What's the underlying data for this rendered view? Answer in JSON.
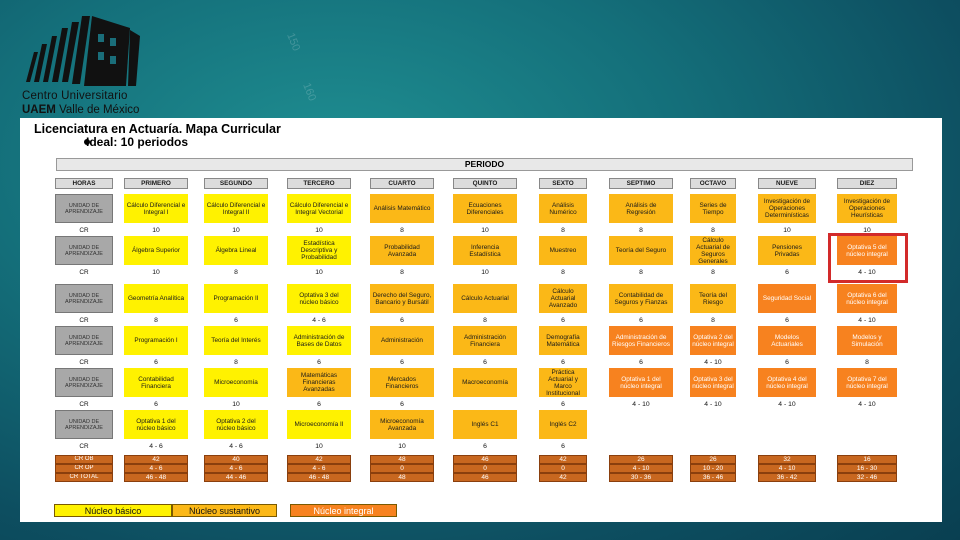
{
  "logo": {
    "line1": "Centro Universitario",
    "line2_bold": "UAEM",
    "line2_rest": " Valle de México"
  },
  "deco": [
    "150",
    "160"
  ],
  "doc": {
    "title": "Licenciatura en Actuaría. Mapa Curricular",
    "subtitle": "Ideal: 10 periodos",
    "periodo": "PERIODO"
  },
  "columns": [
    "HORAS",
    "PRIMERO",
    "SEGUNDO",
    "TERCERO",
    "CUARTO",
    "QUINTO",
    "SEXTO",
    "SEPTIMO",
    "OCTAVO",
    "NUEVE",
    "DIEZ"
  ],
  "row_label": "UNIDAD DE APRENDIZAJE",
  "cr_label": "CR",
  "rows": [
    {
      "cells": [
        {
          "t": "Cálculo Diferencial e Integral I",
          "n": "b"
        },
        {
          "t": "Cálculo Diferencial e Integral II",
          "n": "b"
        },
        {
          "t": "Cálculo Diferencial e Integral Vectorial",
          "n": "b"
        },
        {
          "t": "Análisis Matemático",
          "n": "s"
        },
        {
          "t": "Ecuaciones Diferenciales",
          "n": "s"
        },
        {
          "t": "Análisis Numérico",
          "n": "s"
        },
        {
          "t": "Análisis de Regresión",
          "n": "s"
        },
        {
          "t": "Series de Tiempo",
          "n": "s"
        },
        {
          "t": "Investigación de Operaciones Determinísticas",
          "n": "s"
        },
        {
          "t": "Investigación de Operaciones Heurísticas",
          "n": "s"
        }
      ],
      "cr": [
        "10",
        "10",
        "10",
        "8",
        "10",
        "8",
        "8",
        "8",
        "10",
        "10"
      ]
    },
    {
      "cells": [
        {
          "t": "Álgebra Superior",
          "n": "b"
        },
        {
          "t": "Álgebra Lineal",
          "n": "b"
        },
        {
          "t": "Estadística Descriptiva y Probabilidad",
          "n": "b"
        },
        {
          "t": "Probabilidad Avanzada",
          "n": "s"
        },
        {
          "t": "Inferencia Estadística",
          "n": "s"
        },
        {
          "t": "Muestreo",
          "n": "s"
        },
        {
          "t": "Teoría del Seguro",
          "n": "s"
        },
        {
          "t": "Cálculo Actuarial de Seguros Generales",
          "n": "s"
        },
        {
          "t": "Pensiones Privadas",
          "n": "s"
        },
        {
          "t": "Optativa 5 del núcleo integral",
          "n": "i"
        }
      ],
      "cr": [
        "10",
        "8",
        "10",
        "8",
        "10",
        "8",
        "8",
        "8",
        "6",
        "4 - 10"
      ]
    },
    {
      "cells": [
        {
          "t": "Geometría Analítica",
          "n": "b"
        },
        {
          "t": "Programación II",
          "n": "b"
        },
        {
          "t": "Optativa 3 del núcleo básico",
          "n": "b"
        },
        {
          "t": "Derecho del Seguro, Bancario y Bursátil",
          "n": "s"
        },
        {
          "t": "Cálculo Actuarial",
          "n": "s"
        },
        {
          "t": "Cálculo Actuarial Avanzado",
          "n": "s"
        },
        {
          "t": "Contabilidad de Seguros y Fianzas",
          "n": "s"
        },
        {
          "t": "Teoría del Riesgo",
          "n": "s"
        },
        {
          "t": "Seguridad Social",
          "n": "i"
        },
        {
          "t": "Optativa 6 del núcleo integral",
          "n": "i"
        }
      ],
      "cr": [
        "8",
        "6",
        "4 - 6",
        "6",
        "8",
        "6",
        "6",
        "8",
        "6",
        "4 - 10"
      ]
    },
    {
      "cells": [
        {
          "t": "Programación I",
          "n": "b"
        },
        {
          "t": "Teoría del Interés",
          "n": "b"
        },
        {
          "t": "Administración de Bases de Datos",
          "n": "b"
        },
        {
          "t": "Administración",
          "n": "s"
        },
        {
          "t": "Administración Financiera",
          "n": "s"
        },
        {
          "t": "Demografía Matemática",
          "n": "s"
        },
        {
          "t": "Administración de Riesgos Financieros",
          "n": "i"
        },
        {
          "t": "Optativa 2 del núcleo integral",
          "n": "i"
        },
        {
          "t": "Modelos Actuariales",
          "n": "i"
        },
        {
          "t": "Modelos y Simulación",
          "n": "i"
        }
      ],
      "cr": [
        "6",
        "8",
        "6",
        "6",
        "6",
        "6",
        "6",
        "4 - 10",
        "6",
        "8"
      ]
    },
    {
      "cells": [
        {
          "t": "Contabilidad Financiera",
          "n": "b"
        },
        {
          "t": "Microeconomía",
          "n": "b"
        },
        {
          "t": "Matemáticas Financieras Avanzadas",
          "n": "s"
        },
        {
          "t": "Mercados Financieros",
          "n": "s"
        },
        {
          "t": "Macroeconomía",
          "n": "s"
        },
        {
          "t": "Práctica Actuarial y Marco Institucional",
          "n": "s"
        },
        {
          "t": "Optativa 1 del núcleo integral",
          "n": "i"
        },
        {
          "t": "Optativa 3 del núcleo integral",
          "n": "i"
        },
        {
          "t": "Optativa 4 del núcleo integral",
          "n": "i"
        },
        {
          "t": "Optativa 7 del núcleo integral",
          "n": "i"
        }
      ],
      "cr": [
        "6",
        "10",
        "6",
        "6",
        "",
        "6",
        "4 - 10",
        "4 - 10",
        "4 - 10",
        "4 - 10"
      ]
    },
    {
      "cells": [
        {
          "t": "Optativa 1 del núcleo básico",
          "n": "b"
        },
        {
          "t": "Optativa 2 del núcleo básico",
          "n": "b"
        },
        {
          "t": "Microeconomía II",
          "n": "b"
        },
        {
          "t": "Microeconomía Avanzada",
          "n": "s"
        },
        {
          "t": "Inglés C1",
          "n": "s"
        },
        {
          "t": "Inglés C2",
          "n": "s"
        },
        {
          "t": "",
          "n": "e"
        },
        {
          "t": "",
          "n": "e"
        },
        {
          "t": "",
          "n": "e"
        },
        {
          "t": "",
          "n": "e"
        }
      ],
      "cr": [
        "4 - 6",
        "4 - 6",
        "10",
        "10",
        "6",
        "6",
        "",
        "",
        "",
        ""
      ]
    }
  ],
  "summary": [
    {
      "label": "CR OB",
      "values": [
        "42",
        "40",
        "42",
        "48",
        "46",
        "42",
        "26",
        "26",
        "32",
        "16"
      ]
    },
    {
      "label": "CR OP",
      "values": [
        "4 - 6",
        "4 - 6",
        "4 - 6",
        "0",
        "0",
        "0",
        "4 - 10",
        "10 - 20",
        "4 - 10",
        "16 - 30"
      ]
    },
    {
      "label": "CR TOTAL",
      "values": [
        "46 - 48",
        "44 - 46",
        "46 - 48",
        "48",
        "46",
        "42",
        "30 - 36",
        "36 - 46",
        "36 - 42",
        "32 - 46"
      ]
    }
  ],
  "legend": [
    "Núcleo básico",
    "Núcleo sustantivo",
    "Núcleo integral"
  ],
  "colors": {
    "basico": "#fff200",
    "sustantivo": "#fbb817",
    "integral": "#f7821f",
    "highlight": "#d22a2a"
  }
}
